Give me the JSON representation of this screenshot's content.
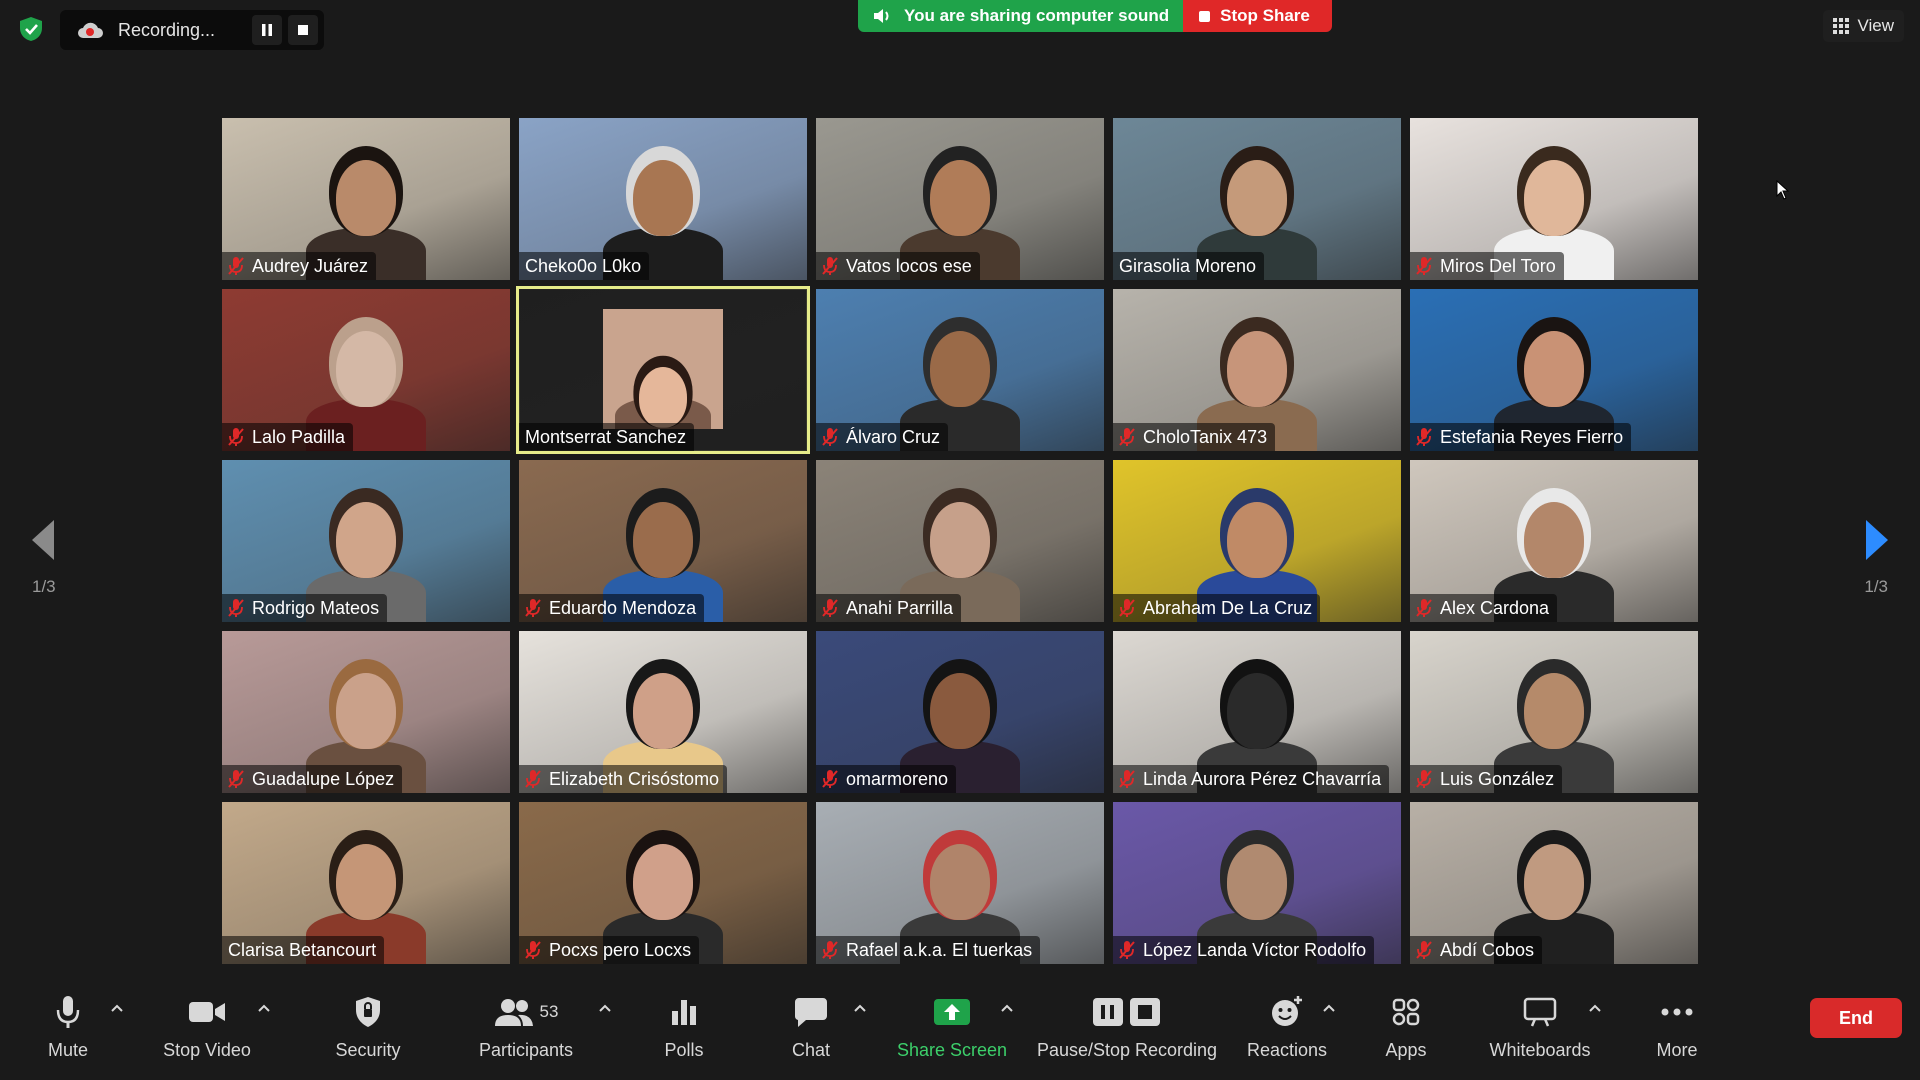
{
  "recording": {
    "label": "Recording...",
    "pause_icon": "pause-icon",
    "stop_icon": "stop-icon"
  },
  "share_banner": {
    "sound_label": "You are sharing computer sound",
    "stop_label": "Stop Share"
  },
  "view": {
    "label": "View"
  },
  "gallery": {
    "page_left": "1/3",
    "page_right": "1/3",
    "participants": [
      {
        "name": "Audrey Juárez",
        "muted": true,
        "bg": "#c9bfae",
        "skin": "#b98a6a",
        "hair": "#1b1410",
        "shirt": "#3a2e28"
      },
      {
        "name": "Cheko0o L0ko",
        "muted": false,
        "bg": "#8aa3c6",
        "skin": "#a87652",
        "hair": "#d8d8d8",
        "shirt": "#1d1d1d"
      },
      {
        "name": "Vatos locos ese",
        "muted": true,
        "bg": "#9a9890",
        "skin": "#b07c58",
        "hair": "#222",
        "shirt": "#4b3a2e"
      },
      {
        "name": "Girasolia Moreno",
        "muted": false,
        "bg": "#6d8797",
        "skin": "#c59a7a",
        "hair": "#2a1d16",
        "shirt": "#2f3a3a"
      },
      {
        "name": "Miros Del Toro",
        "muted": true,
        "bg": "#e8e2de",
        "skin": "#e0b79a",
        "hair": "#3a2a1e",
        "shirt": "#f0f0f0"
      },
      {
        "name": "Lalo Padilla",
        "muted": true,
        "bg": "#8e3b32",
        "skin": "#d4b8a6",
        "hair": "#bba08c",
        "shirt": "#6b2020"
      },
      {
        "name": "Montserrat Sanchez",
        "muted": false,
        "bg": "#1f1f1f",
        "skin": "#e5b79a",
        "hair": "#2a1a14",
        "shirt": "#7a5a4a"
      },
      {
        "name": "Álvaro Cruz",
        "muted": true,
        "bg": "#4d7fb0",
        "skin": "#9a6a48",
        "hair": "#2e2e2e",
        "shirt": "#2a2a2a"
      },
      {
        "name": "CholoTanix 473",
        "muted": true,
        "bg": "#b7b3ab",
        "skin": "#c7957a",
        "hair": "#3b2a20",
        "shirt": "#8a6b50"
      },
      {
        "name": "Estefania Reyes Fierro",
        "muted": true,
        "bg": "#2a6fb5",
        "skin": "#c99275",
        "hair": "#1a1412",
        "shirt": "#1f2630"
      },
      {
        "name": "Rodrigo Mateos",
        "muted": true,
        "bg": "#5f8fb0",
        "skin": "#d0a58a",
        "hair": "#3a2a22",
        "shirt": "#6a6a6a"
      },
      {
        "name": "Eduardo Mendoza",
        "muted": true,
        "bg": "#8a6a50",
        "skin": "#9a6c4c",
        "hair": "#1c1c1c",
        "shirt": "#2a5ea8"
      },
      {
        "name": "Anahi Parrilla",
        "muted": true,
        "bg": "#8b8378",
        "skin": "#c6a08a",
        "hair": "#3b2b22",
        "shirt": "#7a6a5a"
      },
      {
        "name": "Abraham De La Cruz",
        "muted": true,
        "bg": "#e0c42a",
        "skin": "#c08a66",
        "hair": "#2a3a6a",
        "shirt": "#2a4a9a"
      },
      {
        "name": "Alex Cardona",
        "muted": true,
        "bg": "#cfc7bd",
        "skin": "#b3876a",
        "hair": "#e8e8e8",
        "shirt": "#2a2a2a"
      },
      {
        "name": "Guadalupe López",
        "muted": true,
        "bg": "#b89a98",
        "skin": "#caa18a",
        "hair": "#9a6a40",
        "shirt": "#6a5040"
      },
      {
        "name": "Elizabeth Crisóstomo",
        "muted": true,
        "bg": "#e6e2dc",
        "skin": "#cfa088",
        "hair": "#181818",
        "shirt": "#e8c88a"
      },
      {
        "name": "omarmoreno",
        "muted": true,
        "bg": "#3a4a7a",
        "skin": "#8a5a3e",
        "hair": "#141414",
        "shirt": "#2a2030"
      },
      {
        "name": "Linda Aurora Pérez Chavarría",
        "muted": true,
        "bg": "#dcd8d2",
        "skin": "#2a2a2a",
        "hair": "#121212",
        "shirt": "#3a3a3a"
      },
      {
        "name": "Luis González",
        "muted": true,
        "bg": "#d8d4cc",
        "skin": "#b58a6a",
        "hair": "#2a2a2a",
        "shirt": "#3a3a3a"
      },
      {
        "name": "Clarisa Betancourt",
        "muted": false,
        "bg": "#c2a98a",
        "skin": "#c59677",
        "hair": "#2a1e16",
        "shirt": "#8a3a2a"
      },
      {
        "name": "Pocxs pero Locxs",
        "muted": true,
        "bg": "#8a6a4a",
        "skin": "#d0a08a",
        "hair": "#1a1210",
        "shirt": "#2a2a2a"
      },
      {
        "name": "Rafael a.k.a. El tuerkas",
        "muted": true,
        "bg": "#a8aeb4",
        "skin": "#b0846a",
        "hair": "#c03a3a",
        "shirt": "#3a3a3a"
      },
      {
        "name": "López Landa Víctor Rodolfo",
        "muted": true,
        "bg": "#6a58a8",
        "skin": "#b08a70",
        "hair": "#2a2a2a",
        "shirt": "#3a3a3a"
      },
      {
        "name": "Abdí Cobos",
        "muted": true,
        "bg": "#b8b0a6",
        "skin": "#c09a80",
        "hair": "#1a1a1a",
        "shirt": "#202020"
      }
    ]
  },
  "toolbar": {
    "mute": "Mute",
    "stop_video": "Stop Video",
    "security": "Security",
    "participants": "Participants",
    "participants_count": "53",
    "polls": "Polls",
    "chat": "Chat",
    "share_screen": "Share Screen",
    "pause_stop_recording": "Pause/Stop Recording",
    "reactions": "Reactions",
    "apps": "Apps",
    "whiteboards": "Whiteboards",
    "more": "More",
    "end": "End"
  },
  "colors": {
    "active_speaker": "#e6ec8a",
    "share_green": "#1fa34a",
    "stop_red": "#e02828",
    "end_red": "#d92a2a",
    "share_screen_green": "#3ccf6a"
  }
}
